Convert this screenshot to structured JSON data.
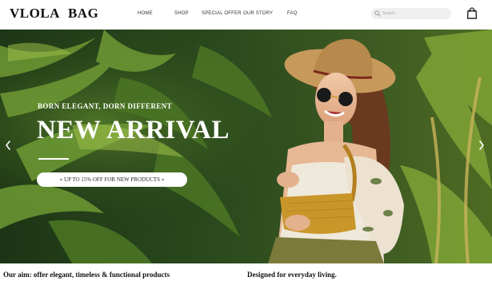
{
  "brand": {
    "logo_word1": "VLOLA",
    "logo_word2": "BAG"
  },
  "nav": {
    "items": [
      {
        "label": "HOME"
      },
      {
        "label": "SHOP"
      },
      {
        "label": "SPECIAL OFFER"
      },
      {
        "label": "OUR STORY"
      },
      {
        "label": "FAQ"
      }
    ]
  },
  "search": {
    "placeholder": "Search",
    "icon": "search-icon"
  },
  "cart": {
    "icon": "shopping-bag-icon"
  },
  "hero": {
    "eyebrow": "BORN ELEGANT, DORN DIFFERENT",
    "title": "NEW ARRIVAL",
    "promo": "» UP TO 15% OFF FOR NEW PRODUCTS «",
    "prev_icon": "chevron-left-icon",
    "next_icon": "chevron-right-icon"
  },
  "taglines": {
    "left": "Our aim: offer elegant, timeless & functional products",
    "right": "Designed for everyday living."
  },
  "colors": {
    "foliage_dark": "#1f3818",
    "foliage_light": "#8fb13c",
    "accent_mustard": "#c9962a",
    "text_dark": "#111111"
  }
}
